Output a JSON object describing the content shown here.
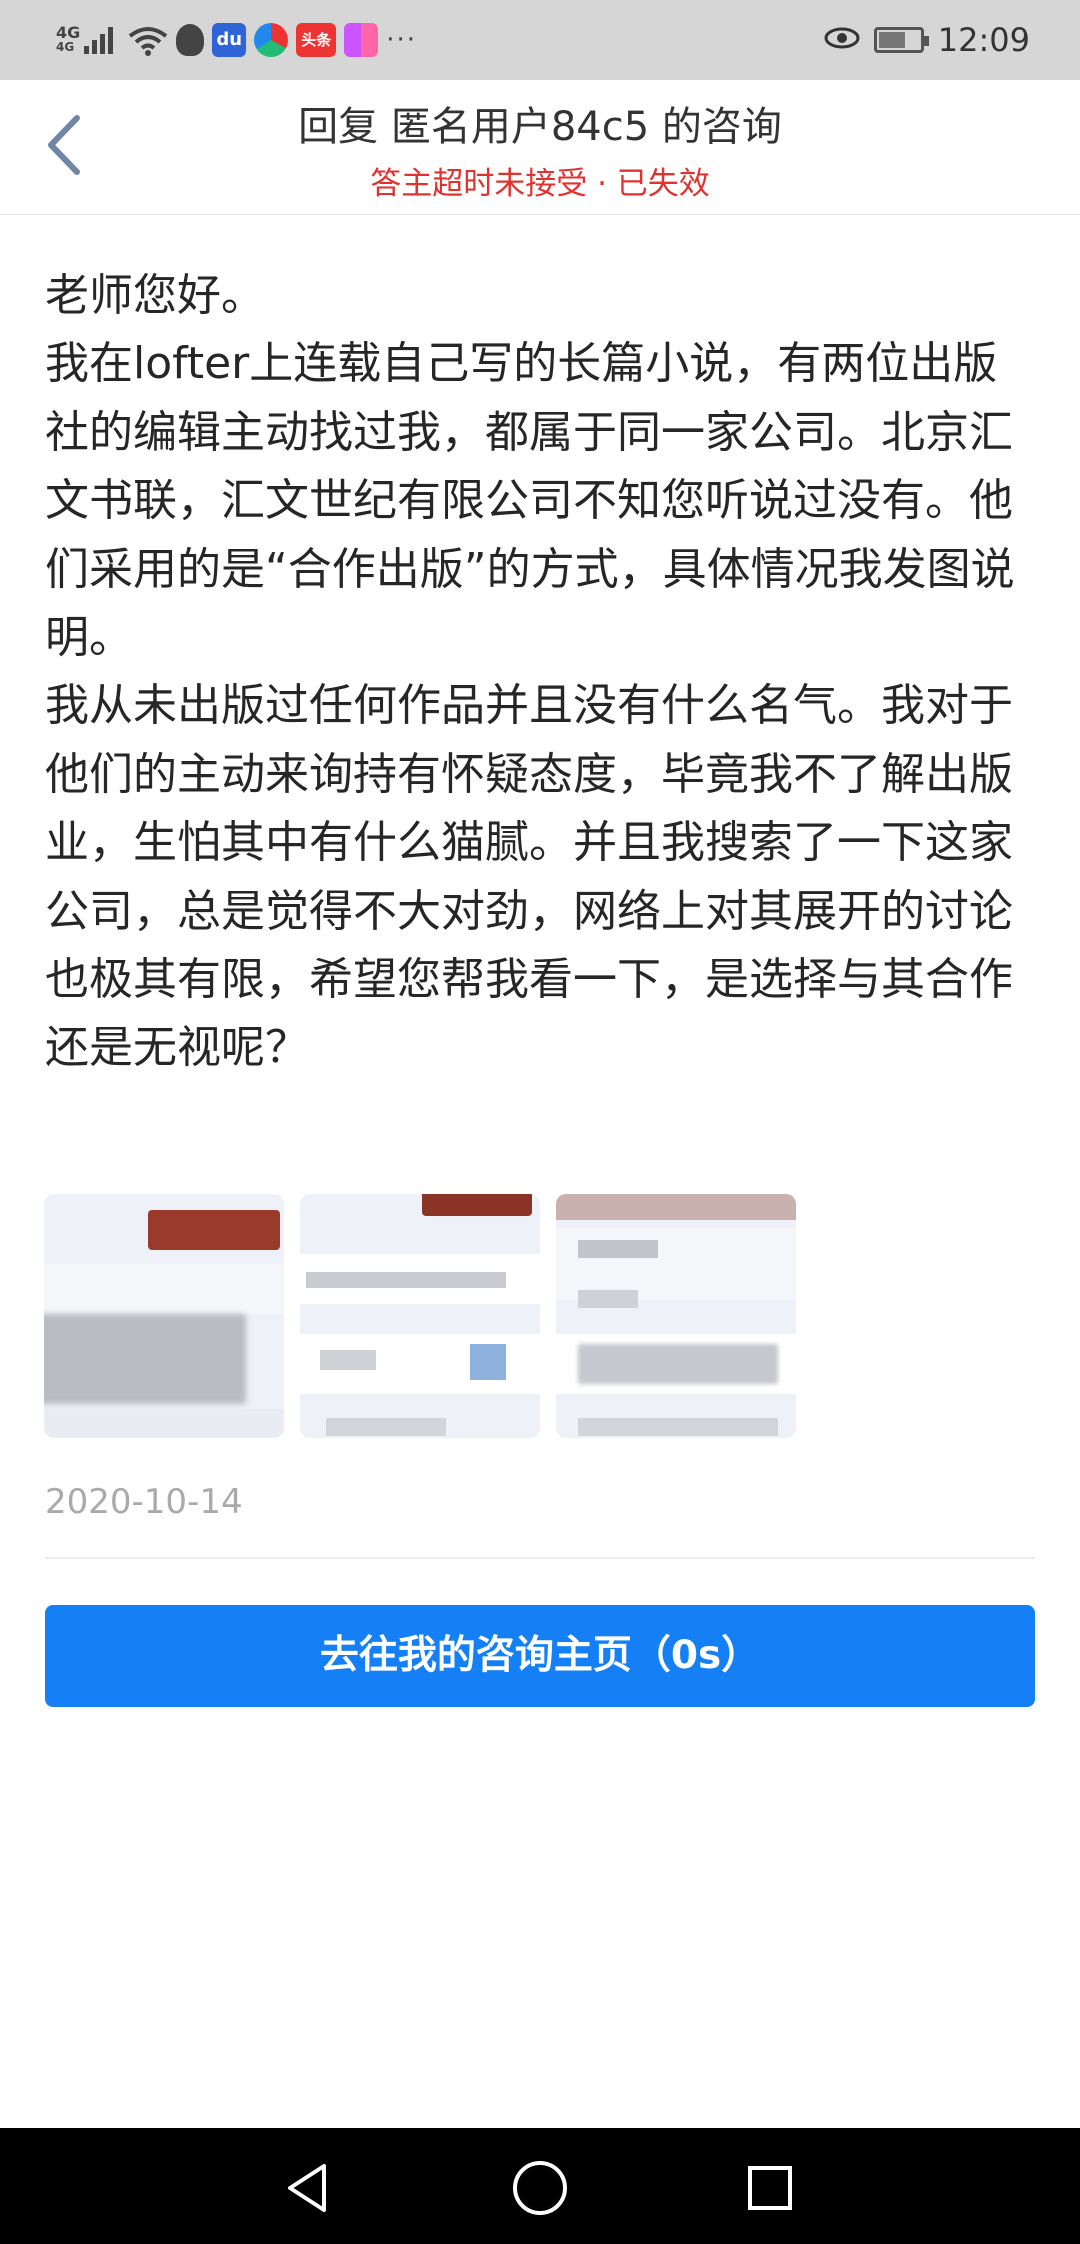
{
  "status_bar": {
    "network": "4G",
    "network_sub": "4G",
    "more": "···",
    "time": "12:09",
    "app_icons": [
      "qq-icon",
      "baidu-icon",
      "circle-app-icon",
      "toutiao-icon",
      "video-app-icon"
    ],
    "toutiao_label": "头条",
    "baidu_label": "du"
  },
  "header": {
    "title": "回复 匿名用户84c5 的咨询",
    "status": "答主超时未接受 · 已失效"
  },
  "consultation": {
    "paragraphs": [
      "老师您好。",
      "我在lofter上连载自己写的长篇小说，有两位出版社的编辑主动找过我，都属于同一家公司。北京汇文书联，汇文世纪有限公司不知您听说过没有。他们采用的是“合作出版”的方式，具体情况我发图说明。",
      "我从未出版过任何作品并且没有什么名气。我对于他们的主动来询持有怀疑态度，毕竟我不了解出版业，生怕其中有什么猫腻。并且我搜索了一下这家公司，总是觉得不大对劲，网络上对其展开的讨论也极其有限，希望您帮我看一下，是选择与其合作还是无视呢？"
    ],
    "date": "2020-10-14"
  },
  "actions": {
    "go_home_label": "去往我的咨询主页（0s）"
  },
  "colors": {
    "accent": "#1580f5",
    "status_red": "#e0322f",
    "date_gray": "#aaaaaa"
  }
}
